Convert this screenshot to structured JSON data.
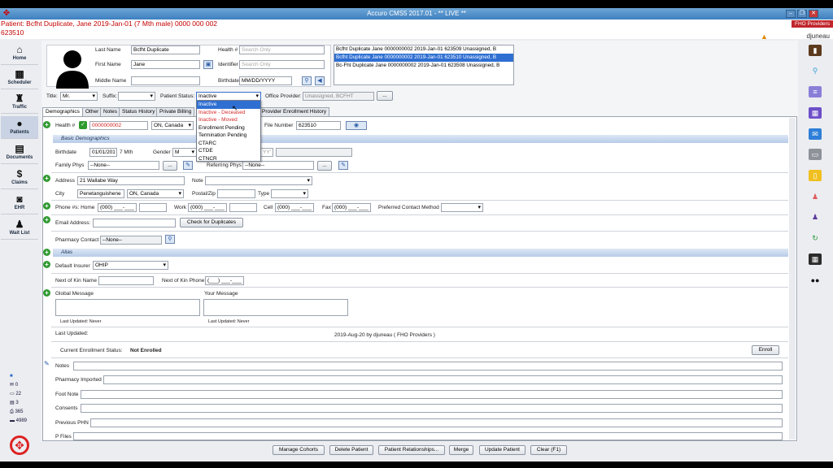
{
  "window": {
    "title": "Accuro CMS5 2017.01 - ** LIVE **"
  },
  "patient_bar": {
    "line1": "Patient: Bcfht Duplicate, Jane 2019-Jan-01 (7 Mth male) 0000 000 002",
    "line2": "623510"
  },
  "header": {
    "org": "FHO Providers",
    "user": "djuneau"
  },
  "left_nav": [
    {
      "label": "Home",
      "icon": "home-icon"
    },
    {
      "label": "Scheduler",
      "icon": "calendar-icon"
    },
    {
      "label": "Traffic",
      "icon": "traffic-icon"
    },
    {
      "label": "Patients",
      "icon": "patient-icon"
    },
    {
      "label": "Documents",
      "icon": "document-icon"
    },
    {
      "label": "Claims",
      "icon": "dollar-icon"
    },
    {
      "label": "EHR",
      "icon": "camera-icon"
    },
    {
      "label": "Wait List",
      "icon": "people-icon"
    }
  ],
  "stats": [
    "0",
    "22",
    "3",
    "365",
    "4989"
  ],
  "form": {
    "last_name_label": "Last Name",
    "last_name": "Bcfht Duplicate",
    "first_name_label": "First Name",
    "first_name": "Jane",
    "middle_name_label": "Middle Name",
    "health_label": "Health #",
    "health_placeholder": "Search Only",
    "identifier_label": "Identifier",
    "identifier_placeholder": "Search Only",
    "birthdate_label": "Birthdate",
    "birthdate_placeholder": "MM/DD/YYYY",
    "title_label": "Title:",
    "title_value": "Mr.",
    "suffix_label": "Suffix:",
    "status_label": "Patient Status:",
    "status_value": "Inactive",
    "office_provider_label": "Office Provider:",
    "office_provider_value": "Unassigned, BCFHT",
    "dots": "..."
  },
  "duplicates": [
    "Bcfht Duplicate  Jane  0000000002  2019-Jan-01  623509  Unassigned, B",
    "Bcfht Duplicate  Jane  0000000002  2019-Jan-01  623510  Unassigned, B",
    "Bc-Fht Duplicate  Jane  0000000002  2019-Jan-01  623508  Unassigned, B"
  ],
  "status_options": [
    "Inactive",
    "Inactive - Deceased",
    "Inactive - Moved",
    "Enrollment Pending",
    "Termination Pending",
    "CTARC",
    "CTDE",
    "CTNCR"
  ],
  "tabs": [
    "Demographics",
    "Other",
    "Notes",
    "Status History",
    "Private Billing",
    "Provider Enrollment History"
  ],
  "details": {
    "health_label": "Health #",
    "health_value": "0000000002",
    "province": "ON, Canada",
    "file_number_label": "File Number",
    "file_number": "623510",
    "basic_demographics": "Basic Demographics",
    "birthdate_label": "Birthdate",
    "birthdate": "01/01/2019",
    "age": "7 Mth",
    "gender_label": "Gender",
    "gender": "M",
    "yyyy": "YYYY",
    "family_phys_label": "Family Phys",
    "family_phys": "--None--",
    "referring_phys_label": "Referring Phys",
    "referring_phys": "--None--",
    "address_label": "Address",
    "address": "21 Wallabe Way",
    "note_label": "Note",
    "city_label": "City",
    "city": "Penetanguishene",
    "city_province": "ON, Canada",
    "postal_label": "Postal/Zip",
    "type_label": "Type",
    "phone_label": "Phone #s: Home",
    "phone_home": "(000) ___-____",
    "work_label": "Work",
    "phone_work": "(000) ___-____",
    "cell_label": "Cell",
    "phone_cell": "(000) ___-____",
    "fax_label": "Fax",
    "phone_fax": "(000) ___-____",
    "pref_contact_label": "Preferred Contact Method",
    "email_label": "Email Address:",
    "check_dup_btn": "Check for Duplicates",
    "pharmacy_label": "Pharmacy Contact",
    "pharmacy": "--None--",
    "alias_label": "Alias",
    "insurer_label": "Default Insurer",
    "insurer": "OHIP",
    "nok_name_label": "Next of Kin Name",
    "nok_phone_label": "Next of Kin Phone",
    "nok_phone": "(___) ___-____",
    "global_msg_label": "Global Message",
    "your_msg_label": "Your Message",
    "last_updated_never": "Last Updated: Never",
    "last_updated_label": "Last Updated:",
    "last_updated_value": "2019-Aug-20 by djuneau ( FHO Providers )",
    "enroll_status_label": "Current Enrollment Status:",
    "enroll_status": "Not Enrolled",
    "enroll_btn": "Enroll",
    "notes_label": "Notes",
    "pharm_imported_label": "Pharmacy Imported",
    "foot_note_label": "Foot Note",
    "consents_label": "Consents",
    "prev_phn_label": "Previous PHN",
    "pfiles_label": "P Files"
  },
  "bottom_buttons": [
    "Manage Cohorts",
    "Delete Patient",
    "Patient Relationships...",
    "Merge",
    "Update Patient",
    "Clear (F1)"
  ]
}
